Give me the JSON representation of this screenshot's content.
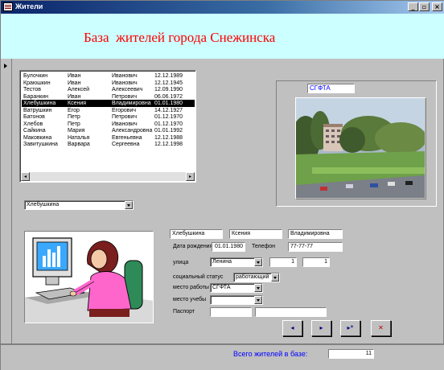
{
  "window": {
    "title": "Жители",
    "minimize": "_",
    "restore": "▫",
    "close": "×"
  },
  "header": {
    "title": "База  жителей города Снежинска",
    "background": "#ccffff",
    "title_color": "#ff0000"
  },
  "residents_list": {
    "rows": [
      [
        "Булочкин",
        "Иван",
        "Иванович",
        "12.12.1989"
      ],
      [
        "Краюшкин",
        "Иван",
        "Иванович",
        "12.12.1945"
      ],
      [
        "Тестов",
        "Алексей",
        "Алексеевич",
        "12.09.1990"
      ],
      [
        "Баранкин",
        "Иван",
        "Петрович",
        "06.06.1972"
      ],
      [
        "Хлебушкина",
        "Ксения",
        "Владимировна",
        "01.01.1980"
      ],
      [
        "Ватрушкин",
        "Егор",
        "Егорович",
        "14.12.1927"
      ],
      [
        "Батонов",
        "Петр",
        "Петрович",
        "01.12.1970"
      ],
      [
        "Хлебов",
        "Петр",
        "Иванович",
        "01.12.1970"
      ],
      [
        "Сайкина",
        "Мария",
        "Александровна",
        "01.01.1992"
      ],
      [
        "Маковкина",
        "Наталья",
        "Евгеньевна",
        "12.12.1988"
      ],
      [
        "Завитушкина",
        "Варвара",
        "Сергеевна",
        "12.12.1998"
      ]
    ],
    "selected_index": 4
  },
  "search_combo": {
    "value": "Хлебушкина"
  },
  "photo_caption": "СГФТА",
  "person": {
    "last_name": "Хлебушкина",
    "first_name": "Ксения",
    "patronymic": "Владимировна",
    "birth_label": "Дата рождения",
    "birth_date": "01.01.1980",
    "phone_label": "Телефон",
    "phone": "77-77-77",
    "street_label": "улица",
    "street": "Ленина",
    "house": "1",
    "apartment": "1",
    "social_status_label": "социальный  статус",
    "social_status": "работающий",
    "workplace_label": "место работы",
    "workplace": "СГФТА",
    "study_label": "место учебы",
    "study": "",
    "passport_label": "Паспорт",
    "passport_series": "",
    "passport_number": ""
  },
  "nav": {
    "prev": "◂",
    "next": "▸",
    "new": "▸*",
    "delete": "✕"
  },
  "footer": {
    "total_label": "Всего жителей в базе:",
    "total_value": "11"
  }
}
